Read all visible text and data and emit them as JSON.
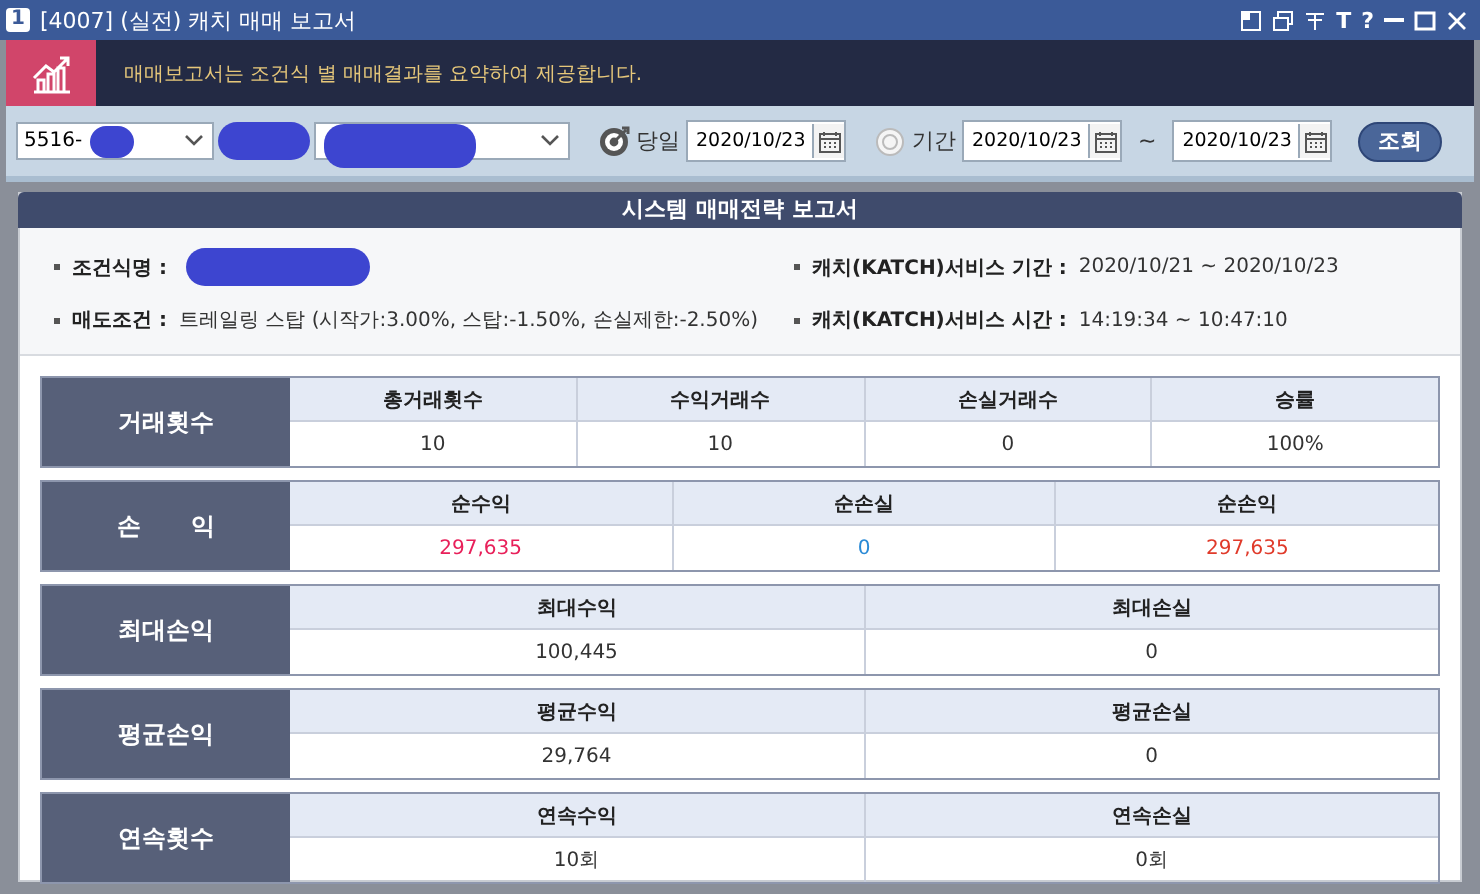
{
  "window": {
    "number": "1",
    "title": "[4007] (실전) 캐치 매매 보고서",
    "tool_glyphs": [
      "T",
      "?"
    ]
  },
  "banner": {
    "text": "매매보고서는 조건식 별 매매결과를 요약하여 제공합니다."
  },
  "toolbar": {
    "account": "5516-",
    "modes": [
      {
        "label": "당일",
        "selected": true,
        "dates": [
          "2020/10/23"
        ]
      },
      {
        "label": "기간",
        "selected": false,
        "dates": [
          "2020/10/23",
          "2020/10/23"
        ],
        "separator": "~"
      }
    ],
    "search_button": "조회"
  },
  "report": {
    "title": "시스템 매매전략 보고서",
    "info": [
      {
        "label": "조건식명 :",
        "redacted": true
      },
      {
        "label": "캐치(KATCH)서비스 기간 :",
        "value": "2020/10/21 ~ 2020/10/23"
      },
      {
        "label": "매도조건 :",
        "value": "트레일링 스탑 (시작가:3.00%, 스탑:-1.50%, 손실제한:-2.50%)"
      },
      {
        "label": "캐치(KATCH)서비스 시간 :",
        "value": "14:19:34 ~ 10:47:10"
      }
    ],
    "tables": [
      {
        "label": "거래횟수",
        "columns": [
          {
            "header": "총거래횟수",
            "value": "10",
            "color": "#333333"
          },
          {
            "header": "수익거래수",
            "value": "10",
            "color": "#333333"
          },
          {
            "header": "손실거래수",
            "value": "0",
            "color": "#333333"
          },
          {
            "header": "승률",
            "value": "100%",
            "color": "#333333"
          }
        ]
      },
      {
        "label": "손      익",
        "columns": [
          {
            "header": "순수익",
            "value": "297,635",
            "color": "#e8205a"
          },
          {
            "header": "순손실",
            "value": "0",
            "color": "#2a8ad6"
          },
          {
            "header": "순손익",
            "value": "297,635",
            "color": "#e03a2a"
          }
        ]
      },
      {
        "label": "최대손익",
        "columns": [
          {
            "header": "최대수익",
            "value": "100,445",
            "color": "#333333"
          },
          {
            "header": "최대손실",
            "value": "0",
            "color": "#333333"
          }
        ]
      },
      {
        "label": "평균손익",
        "columns": [
          {
            "header": "평균수익",
            "value": "29,764",
            "color": "#333333"
          },
          {
            "header": "평균손실",
            "value": "0",
            "color": "#333333"
          }
        ]
      },
      {
        "label": "연속횟수",
        "columns": [
          {
            "header": "연속수익",
            "value": "10회",
            "color": "#333333"
          },
          {
            "header": "연속손실",
            "value": "0회",
            "color": "#333333"
          }
        ]
      }
    ]
  }
}
